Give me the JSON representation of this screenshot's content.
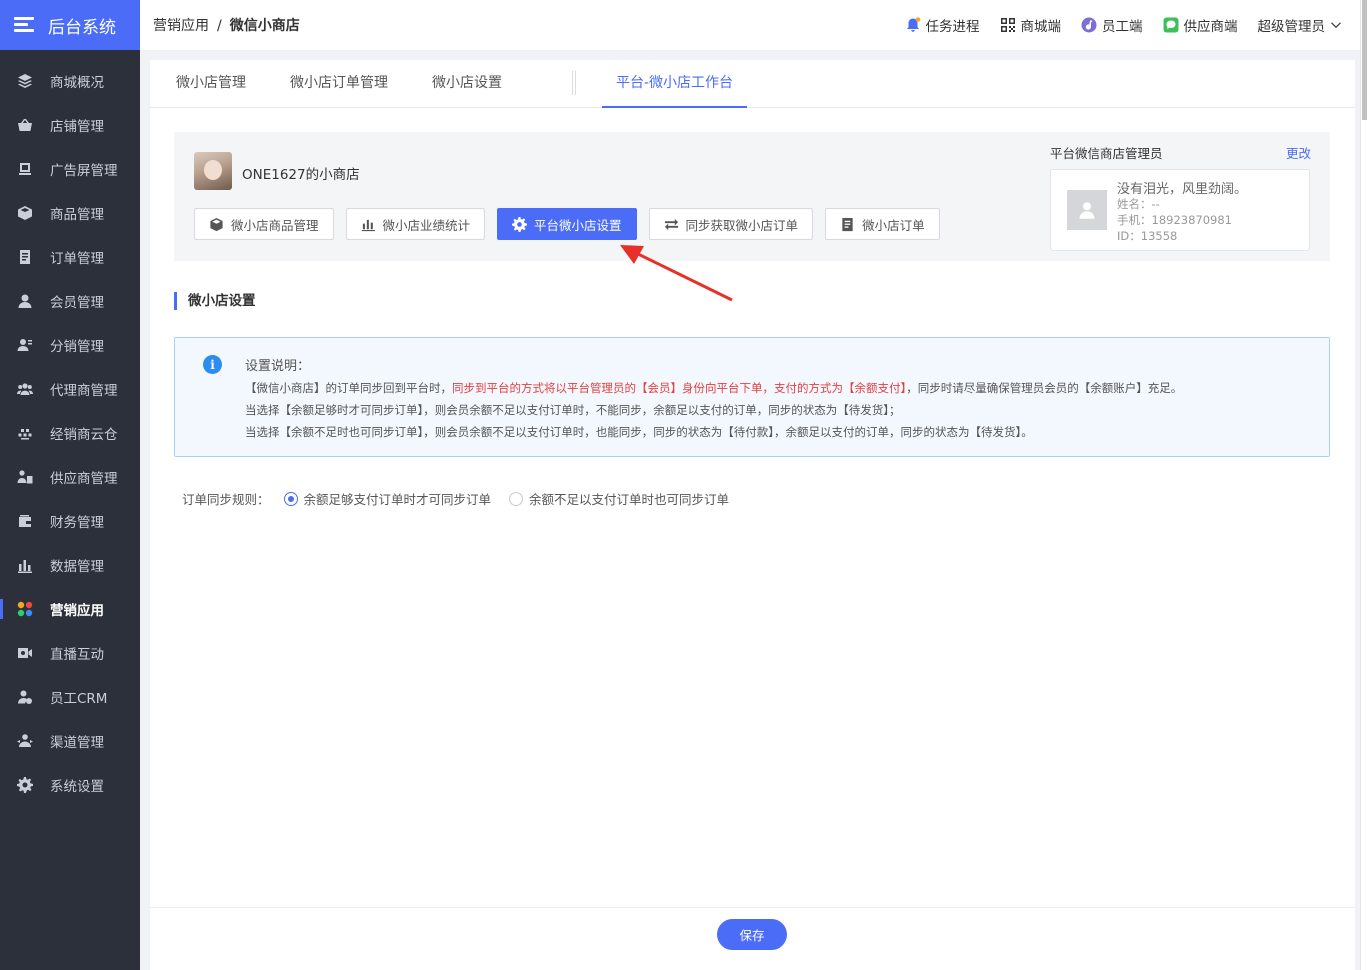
{
  "brand": {
    "title": "后台系统"
  },
  "sidebar": {
    "items": [
      {
        "label": "商城概况",
        "icon": "layers-icon"
      },
      {
        "label": "店铺管理",
        "icon": "shop-basket-icon"
      },
      {
        "label": "广告屏管理",
        "icon": "screen-icon"
      },
      {
        "label": "商品管理",
        "icon": "box-icon"
      },
      {
        "label": "订单管理",
        "icon": "document-icon"
      },
      {
        "label": "会员管理",
        "icon": "user-icon"
      },
      {
        "label": "分销管理",
        "icon": "users-share-icon"
      },
      {
        "label": "代理商管理",
        "icon": "group-icon"
      },
      {
        "label": "经销商云仓",
        "icon": "cloud-stack-icon"
      },
      {
        "label": "供应商管理",
        "icon": "supplier-icon"
      },
      {
        "label": "财务管理",
        "icon": "wallet-icon"
      },
      {
        "label": "数据管理",
        "icon": "bar-chart-icon"
      },
      {
        "label": "营销应用",
        "icon": "apps-color-icon",
        "active": true
      },
      {
        "label": "直播互动",
        "icon": "video-icon"
      },
      {
        "label": "员工CRM",
        "icon": "staff-icon"
      },
      {
        "label": "渠道管理",
        "icon": "channel-icon"
      },
      {
        "label": "系统设置",
        "icon": "gear-icon"
      }
    ]
  },
  "header": {
    "breadcrumb_parent": "营销应用",
    "breadcrumb_sep": "/",
    "breadcrumb_current": "微信小商店",
    "task": "任务进程",
    "mall": "商城端",
    "staff": "员工端",
    "supplier": "供应商端",
    "user": "超级管理员"
  },
  "tabs": [
    "微小店管理",
    "微小店订单管理",
    "微小店设置",
    "平台-微小店工作台"
  ],
  "store": {
    "name": "ONE1627的小商店",
    "buttons": [
      "微小店商品管理",
      "微小店业绩统计",
      "平台微小店设置",
      "同步获取微小店订单",
      "微小店订单"
    ]
  },
  "manager": {
    "title": "平台微信商店管理员",
    "change": "更改",
    "nickname": "没有泪光，风里劲阔。",
    "name_line": "姓名：--",
    "phone_line": "手机：18923870981",
    "id_line": "ID：13558"
  },
  "section_title": "微小店设置",
  "notice": {
    "title": "设置说明：",
    "line1_a": "【微信小商店】的订单同步回到平台时，",
    "line1_red": "同步到平台的方式将以平台管理员的【会员】身份向平台下单，支付的方式为【余额支付】",
    "line1_b": "，同步时请尽量确保管理员会员的【余额账户】充足。",
    "line2": "当选择【余额足够时才可同步订单】，则会员余额不足以支付订单时，不能同步，余额足以支付的订单，同步的状态为【待发货】；",
    "line3": "当选择【余额不足时也可同步订单】，则会员余额不足以支付订单时，也能同步，同步的状态为【待付款】，余额足以支付的订单，同步的状态为【待发货】。"
  },
  "rule": {
    "label": "订单同步规则：",
    "option1": "余额足够支付订单时才可同步订单",
    "option2": "余额不足以支付订单时也可同步订单",
    "selected": 1
  },
  "save_label": "保存",
  "colors": {
    "accent": "#4a6cf7",
    "sidebar_bg": "#2b303b",
    "highlight_red": "#e53f3f"
  }
}
